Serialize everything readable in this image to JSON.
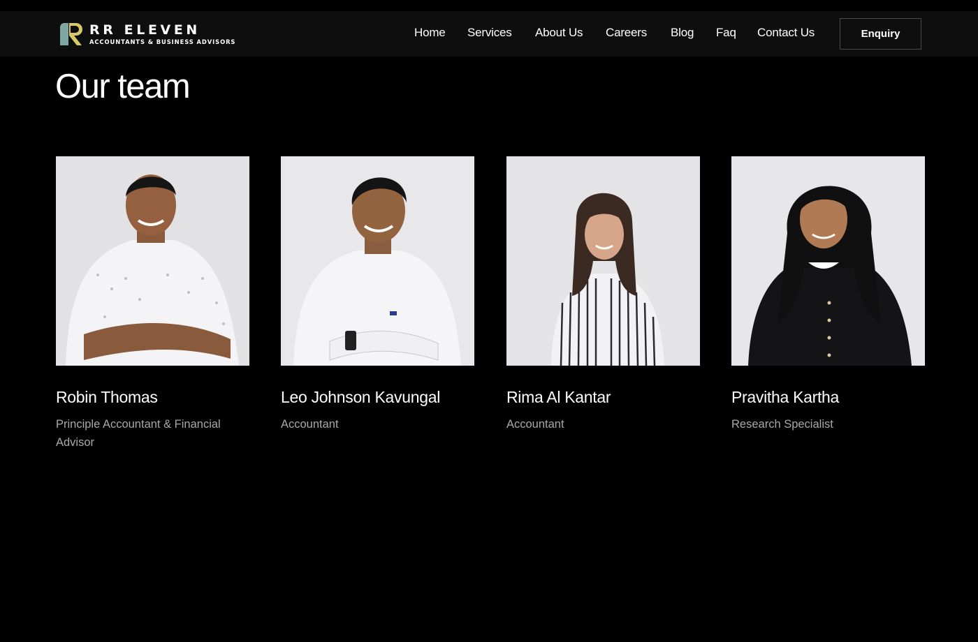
{
  "brand": {
    "name": "RR ELEVEN",
    "tagline": "ACCOUNTANTS & BUSINESS ADVISORS",
    "colors": {
      "mark_teal": "#7fa7a3",
      "mark_gold": "#d8c86a"
    }
  },
  "nav": {
    "items": [
      {
        "label": "Home"
      },
      {
        "label": "Services"
      },
      {
        "label": "About Us"
      },
      {
        "label": "Careers"
      },
      {
        "label": "Blog"
      },
      {
        "label": "Faq"
      },
      {
        "label": "Contact Us"
      }
    ],
    "cta_label": "Enquiry"
  },
  "page": {
    "title": "Our team"
  },
  "team": [
    {
      "name": "Robin Thomas",
      "role": "Principle Accountant & Financial Advisor"
    },
    {
      "name": "Leo Johnson Kavungal",
      "role": "Accountant"
    },
    {
      "name": "Rima Al Kantar",
      "role": "Accountant"
    },
    {
      "name": "Pravitha Kartha",
      "role": "Research Specialist"
    }
  ]
}
